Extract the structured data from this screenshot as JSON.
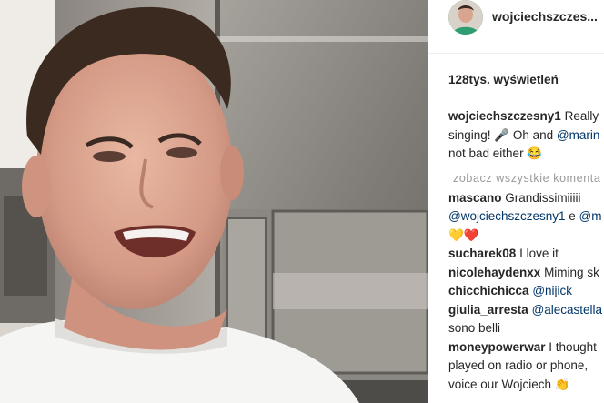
{
  "post": {
    "username": "wojciechszczes...",
    "views": "128tys. wyświetleń",
    "caption": {
      "user": "wojciechszczesny1",
      "line1": "Really",
      "line2_a": "singing! 🎤 Oh and ",
      "line2_mention": "@marin",
      "line3": "not bad either 😂"
    },
    "see_all": "zobacz wszystkie komenta",
    "comments": [
      {
        "user": "mascano",
        "text": "Grandissimiiiii"
      },
      {
        "user": "sucharek08",
        "text": "I love it"
      },
      {
        "user": "nicolehaydenxx",
        "text": "Miming sk"
      },
      {
        "user": "chicchichicca",
        "text": "@nijick"
      },
      {
        "user": "giulia_arresta",
        "text": "@alecastella"
      },
      {
        "user": "moneypowerwar",
        "text": "I thought"
      }
    ],
    "mascano_line2_a": "@wojciechszczesny1",
    "mascano_line2_b": " e ",
    "mascano_line2_c": "@m",
    "mascano_line3": "💛❤️",
    "giulia_line2": "sono belli",
    "money_line2": "played on radio or phone,",
    "money_line3": "voice our Wojciech 👏"
  },
  "icons": [
    "avatar",
    "play-video"
  ]
}
